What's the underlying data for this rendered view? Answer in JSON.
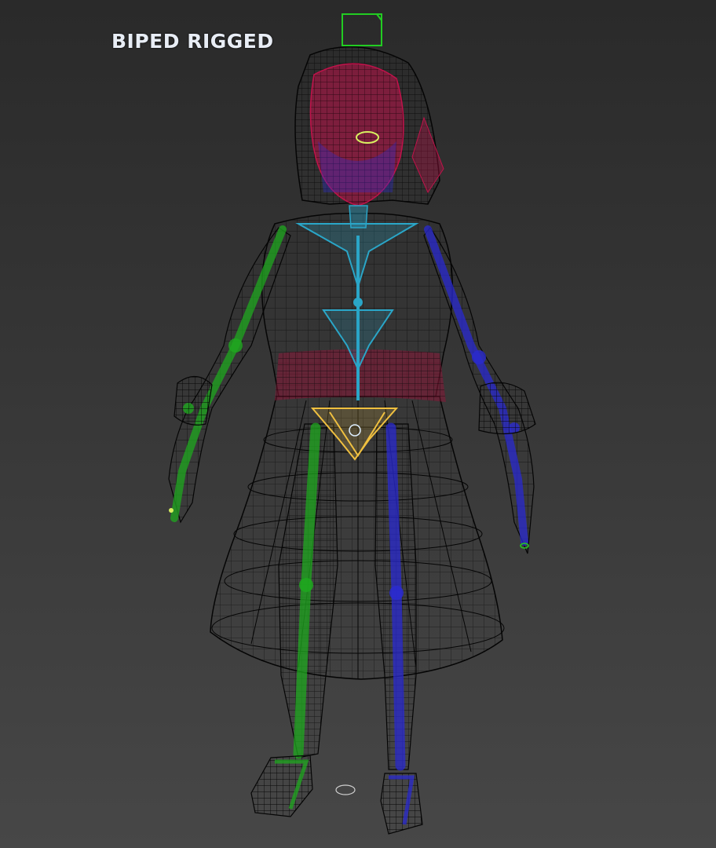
{
  "viewport": {
    "label": "BIPED RIGGED"
  },
  "colors": {
    "background_top": "#2a2a2a",
    "background_bottom": "#474747",
    "mesh_wire": "#050505",
    "head_bone": "#c0124a",
    "left_limbs": "#1fa81f",
    "right_limbs": "#2a2ad0",
    "spine": "#2aa6c8",
    "pelvis": "#f0c040",
    "torso_sash": "#8a1838",
    "ponytail_control": "#22cc22",
    "label_text": "#e8edf5"
  }
}
